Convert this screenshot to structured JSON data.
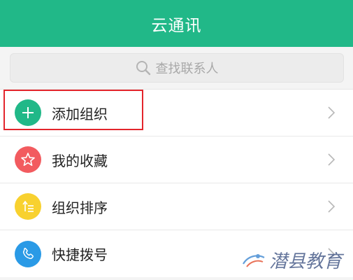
{
  "header": {
    "title": "云通讯"
  },
  "search": {
    "placeholder": "查找联系人",
    "icon": "search-icon"
  },
  "list": {
    "items": [
      {
        "label": "添加组织",
        "icon": "plus-icon",
        "icon_color": "#21b888"
      },
      {
        "label": "我的收藏",
        "icon": "star-icon",
        "icon_color": "#f25b5f"
      },
      {
        "label": "组织排序",
        "icon": "sort-icon",
        "icon_color": "#f8d12f"
      },
      {
        "label": "快捷拨号",
        "icon": "phone-icon",
        "icon_color": "#2a9ae6"
      }
    ]
  },
  "highlight": {
    "target": "添加组织",
    "color": "#e3252c"
  },
  "watermark": {
    "text": "潜县教育"
  },
  "colors": {
    "header_bg": "#21b888",
    "page_bg": "#f4f4f4",
    "text": "#222222"
  }
}
